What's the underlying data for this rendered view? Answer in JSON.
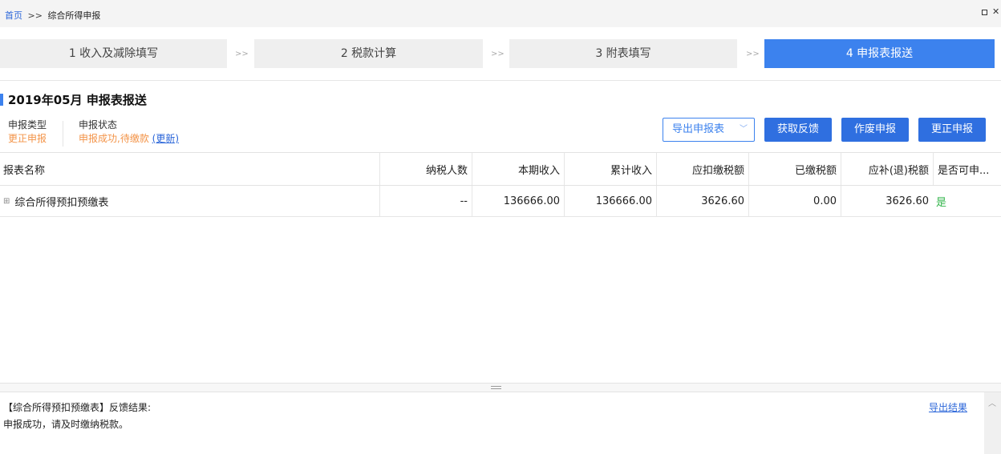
{
  "breadcrumb": {
    "home": "首页",
    "separator": ">>",
    "current": "综合所得申报"
  },
  "steps": [
    {
      "label": "1 收入及减除填写",
      "active": false
    },
    {
      "label": "2 税款计算",
      "active": false
    },
    {
      "label": "3 附表填写",
      "active": false
    },
    {
      "label": "4 申报表报送",
      "active": true
    }
  ],
  "step_separator": ">>",
  "section": {
    "title": "2019年05月  申报表报送"
  },
  "meta": {
    "type_label": "申报类型",
    "type_value": "更正申报",
    "status_label": "申报状态",
    "status_value": "申报成功,待缴款",
    "refresh_link": "(更新)"
  },
  "actions": {
    "export_label": "导出申报表",
    "feedback_label": "获取反馈",
    "void_label": "作废申报",
    "correct_label": "更正申报"
  },
  "table": {
    "headers": [
      "报表名称",
      "纳税人数",
      "本期收入",
      "累计收入",
      "应扣缴税额",
      "已缴税额",
      "应补(退)税额",
      "是否可申..."
    ],
    "rows": [
      {
        "name": "综合所得预扣预缴表",
        "taxpayers": "--",
        "current_income": "136666.00",
        "cumulative_income": "136666.00",
        "tax_withheld": "3626.60",
        "tax_paid": "0.00",
        "tax_due": "3626.60",
        "can_declare": "是"
      }
    ]
  },
  "feedback": {
    "heading": "【综合所得预扣预缴表】反馈结果:",
    "message": "申报成功，请及时缴纳税款。",
    "export_link": "导出结果"
  },
  "colors": {
    "primary": "#3c82ee",
    "button": "#2f6fe0",
    "warning": "#f39449",
    "success": "#32b44a",
    "link": "#2b66d9"
  }
}
